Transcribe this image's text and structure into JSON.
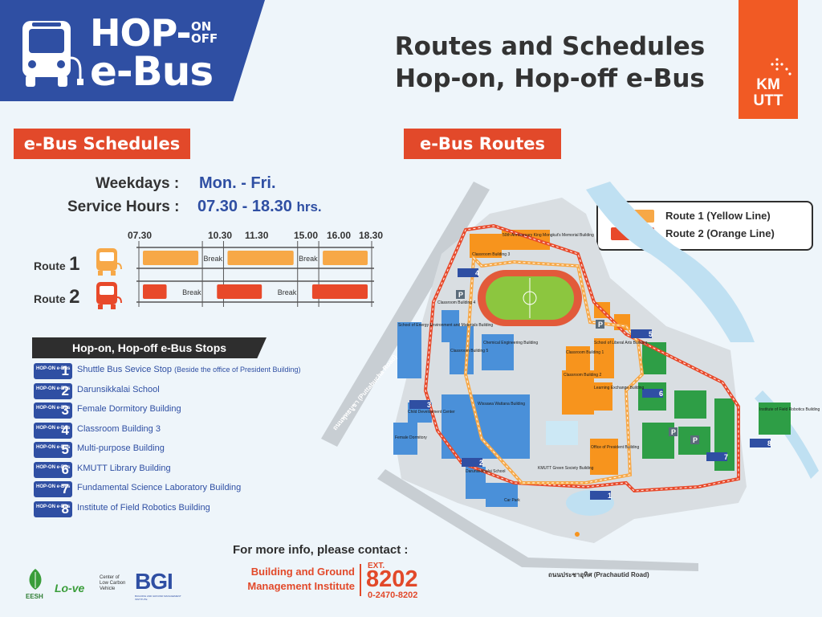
{
  "header": {
    "logo_line1": "HOP-",
    "logo_on": "ON",
    "logo_off": "OFF",
    "logo_line2": "e-Bus",
    "title_line1": "Routes and Schedules",
    "title_line2": "Hop-on, Hop-off e-Bus",
    "brand_line1": "KM",
    "brand_line2": "UTT"
  },
  "schedules": {
    "heading": "e-Bus Schedules",
    "weekdays_label": "Weekdays",
    "weekdays_value": "Mon. - Fri.",
    "hours_label": "Service Hours",
    "hours_value": "07.30 - 18.30",
    "hours_unit": "hrs.",
    "colon": ":",
    "ticks": [
      "07.30",
      "10.30",
      "11.30",
      "15.00",
      "16.00",
      "18.30"
    ],
    "routes": [
      {
        "label": "Route",
        "num": "1",
        "color": "#f7a847"
      },
      {
        "label": "Route",
        "num": "2",
        "color": "#e8492a"
      }
    ],
    "break_label": "Break"
  },
  "stops": {
    "heading": "Hop-on, Hop-off e-Bus Stops",
    "badge_text": "HOP-ON e-Bus",
    "items": [
      {
        "num": "1",
        "name": "Shuttle Bus Sevice Stop",
        "note": "(Beside the office of President Building)"
      },
      {
        "num": "2",
        "name": "Darunsikkalai School",
        "note": ""
      },
      {
        "num": "3",
        "name": "Female Dormitory Building",
        "note": ""
      },
      {
        "num": "4",
        "name": "Classroom Building 3",
        "note": ""
      },
      {
        "num": "5",
        "name": "Multi-purpose Building",
        "note": ""
      },
      {
        "num": "6",
        "name": "KMUTT Library Building",
        "note": ""
      },
      {
        "num": "7",
        "name": "Fundamental Science Laboratory Building",
        "note": ""
      },
      {
        "num": "8",
        "name": "Institute of Field Robotics Building",
        "note": ""
      }
    ]
  },
  "routes_map": {
    "heading": "e-Bus Routes",
    "legend": [
      {
        "label": "Route 1 (Yellow Line)",
        "color": "#f7a847"
      },
      {
        "label": "Route 2 (Orange Line)",
        "color": "#e8492a"
      }
    ],
    "road_left": "ถนนพุทธบูชา (Puttabucha Road)",
    "road_bottom": "ถนนประชาอุทิศ (Prachautid Road)",
    "labels": {
      "chemical": "Chemical Engineering Building",
      "classroom3": "Classroom Building 3",
      "classroom5": "Classroom Building 5",
      "classroom4": "Classroom Building 4",
      "classroom1": "Classroom Building 1",
      "classroom2": "Classroom Building 2",
      "liberal": "School of Liberal Arts Building",
      "learning": "Learning Exchange Building",
      "wissawa": "Wissawa Wattana Building",
      "president": "Office of President Building",
      "green": "KMUTT Green Society Building",
      "female": "Female Dormitory",
      "child": "Child Development Center",
      "darun": "Darunsikkhalai School",
      "robotics": "Institute of Field Robotics Building",
      "school_energy": "School of Energy Environment and Materials Building",
      "anniversary": "50th Anniversary King Mongkut's Memorial Building",
      "parking": "P",
      "car_park": "Car Park",
      "stop1": "1",
      "stop2": "2",
      "stop3": "3",
      "stop4": "4",
      "stop5": "5",
      "stop6": "6",
      "stop7": "7",
      "stop8": "8"
    }
  },
  "contact": {
    "title": "For more info, please contact :",
    "dept_line1": "Building and Ground",
    "dept_line2": "Management Institute",
    "ext_label": "EXT.",
    "ext_num": "8202",
    "phone": "0-2470-8202"
  },
  "partners": {
    "eesh": "EESH",
    "lcv_name": "Lo-ve",
    "lcv_desc1": "Center of",
    "lcv_desc2": "Low Carbon",
    "lcv_desc3": "Vehicle",
    "bgi": "BGI",
    "bgi_desc": "BUILDING AND GROUND MANAGEMENT INSTITUTE"
  }
}
